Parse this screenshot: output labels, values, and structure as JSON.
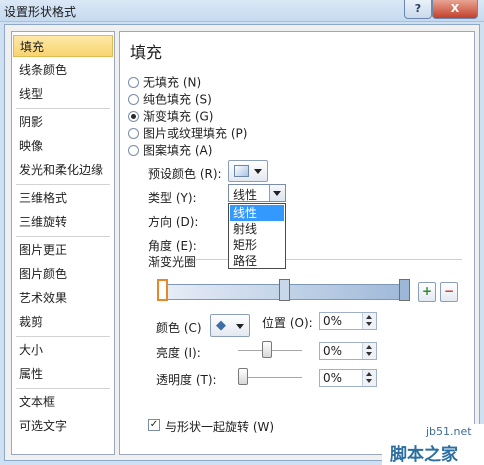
{
  "window": {
    "title": "设置形状格式",
    "help_label": "?",
    "close_label": "X"
  },
  "sidebar": {
    "items": [
      {
        "label": "填充",
        "selected": true
      },
      {
        "label": "线条颜色"
      },
      {
        "label": "线型"
      },
      {
        "label": "阴影"
      },
      {
        "label": "映像"
      },
      {
        "label": "发光和柔化边缘"
      },
      {
        "label": "三维格式"
      },
      {
        "label": "三维旋转"
      },
      {
        "label": "图片更正"
      },
      {
        "label": "图片颜色"
      },
      {
        "label": "艺术效果"
      },
      {
        "label": "裁剪"
      },
      {
        "label": "大小"
      },
      {
        "label": "属性"
      },
      {
        "label": "文本框"
      },
      {
        "label": "可选文字"
      }
    ]
  },
  "panel": {
    "heading": "填充",
    "fill_options": [
      {
        "label": "无填充 (N)",
        "selected": false
      },
      {
        "label": "纯色填充 (S)",
        "selected": false
      },
      {
        "label": "渐变填充 (G)",
        "selected": true
      },
      {
        "label": "图片或纹理填充 (P)",
        "selected": false
      },
      {
        "label": "图案填充 (A)",
        "selected": false
      }
    ],
    "preset_label": "预设颜色 (R):",
    "type_label": "类型 (Y):",
    "type_value": "线性",
    "type_options": [
      "线性",
      "射线",
      "矩形",
      "路径"
    ],
    "direction_label": "方向 (D):",
    "angle_label": "角度 (E):",
    "gradient_stops_label": "渐变光圈",
    "color_label": "颜色 (C)",
    "position_label": "位置 (O):",
    "position_value": "0%",
    "brightness_label": "亮度 (I):",
    "brightness_value": "0%",
    "brightness_level": 0.45,
    "transparency_label": "透明度 (T):",
    "transparency_value": "0%",
    "transparency_level": 0,
    "rotate_label": "与形状一起旋转 (W)",
    "rotate_checked": true,
    "check_mark": "✓",
    "bucket_glyph": "◆"
  },
  "watermark": {
    "url": "jb51.net",
    "text": "脚本之家"
  }
}
